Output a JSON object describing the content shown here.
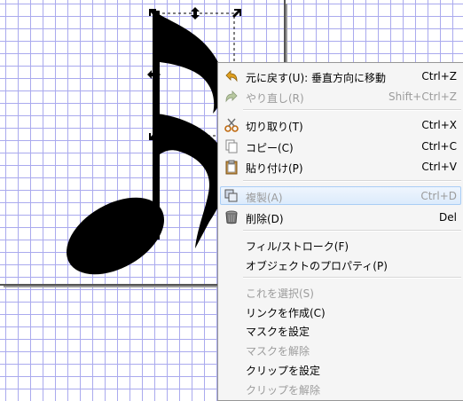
{
  "menu": {
    "items": [
      {
        "label": "元に戻す(U): 垂直方向に移動",
        "shortcut": "Ctrl+Z",
        "icon": "undo-icon",
        "disabled": false
      },
      {
        "label": "やり直し(R)",
        "shortcut": "Shift+Ctrl+Z",
        "icon": "redo-icon",
        "disabled": true
      },
      {
        "label": "切り取り(T)",
        "shortcut": "Ctrl+X",
        "icon": "scissors-icon",
        "disabled": false
      },
      {
        "label": "コピー(C)",
        "shortcut": "Ctrl+C",
        "icon": "copy-icon",
        "disabled": false
      },
      {
        "label": "貼り付け(P)",
        "shortcut": "Ctrl+V",
        "icon": "paste-icon",
        "disabled": false
      },
      {
        "label": "複製(A)",
        "shortcut": "Ctrl+D",
        "icon": "duplicate-icon",
        "disabled": true,
        "highlighted": true
      },
      {
        "label": "削除(D)",
        "shortcut": "Del",
        "icon": "trash-icon",
        "disabled": false
      },
      {
        "label": "フィル/ストローク(F)",
        "shortcut": "",
        "icon": "",
        "disabled": false
      },
      {
        "label": "オブジェクトのプロパティ(P)",
        "shortcut": "",
        "icon": "",
        "disabled": false
      },
      {
        "label": "これを選択(S)",
        "shortcut": "",
        "icon": "",
        "disabled": true
      },
      {
        "label": "リンクを作成(C)",
        "shortcut": "",
        "icon": "",
        "disabled": false
      },
      {
        "label": "マスクを設定",
        "shortcut": "",
        "icon": "",
        "disabled": false
      },
      {
        "label": "マスクを解除",
        "shortcut": "",
        "icon": "",
        "disabled": true
      },
      {
        "label": "クリップを設定",
        "shortcut": "",
        "icon": "",
        "disabled": false
      },
      {
        "label": "クリップを解除",
        "shortcut": "",
        "icon": "",
        "disabled": true
      }
    ]
  },
  "colors": {
    "grid": "#aaaaee",
    "menu_bg": "#f5f5f5",
    "disabled_text": "#9c9c9c",
    "highlight_border": "#a9cdf5"
  }
}
